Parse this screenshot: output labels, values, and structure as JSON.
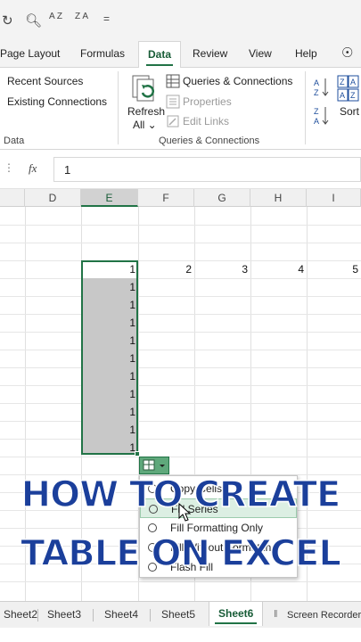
{
  "qat": {
    "sort_az": "A Z",
    "sort_za": "Z A",
    "dropdown": "="
  },
  "tabs": [
    "Page Layout",
    "Formulas",
    "Data",
    "Review",
    "View",
    "Help"
  ],
  "ribbon": {
    "recent_sources": "Recent Sources",
    "existing_connections": "Existing Connections",
    "data_group_label": "Data",
    "refresh_label": "Refresh",
    "refresh_all": "All",
    "queries_connections": "Queries & Connections",
    "properties": "Properties",
    "edit_links": "Edit Links",
    "qc_group_label": "Queries & Connections",
    "sort_label": "Sort"
  },
  "formula_bar": {
    "fx": "fx",
    "value": "1"
  },
  "columns": [
    "D",
    "E",
    "F",
    "G",
    "H",
    "I"
  ],
  "row_values": {
    "first_row": [
      "1",
      "2",
      "3",
      "4",
      "5"
    ],
    "filled_e": [
      "1",
      "1",
      "1",
      "1",
      "1",
      "1",
      "1",
      "1",
      "1",
      "1"
    ]
  },
  "autofill_menu": {
    "items": [
      "Copy Cells",
      "Fill Series",
      "Fill Formatting Only",
      "Fill Without Formatting",
      "Flash Fill"
    ]
  },
  "overlay": {
    "line1": "HOW TO CREATE",
    "line2": "TABLE ON EXCEL"
  },
  "sheets": [
    "Sheet2",
    "Sheet3",
    "Sheet4",
    "Sheet5",
    "Sheet6"
  ],
  "status": {
    "screen_recorder": "Screen Recorder"
  },
  "colors": {
    "accent": "#217346",
    "overlay_text": "#1b3f9b",
    "selection": "#c8c8c8"
  }
}
